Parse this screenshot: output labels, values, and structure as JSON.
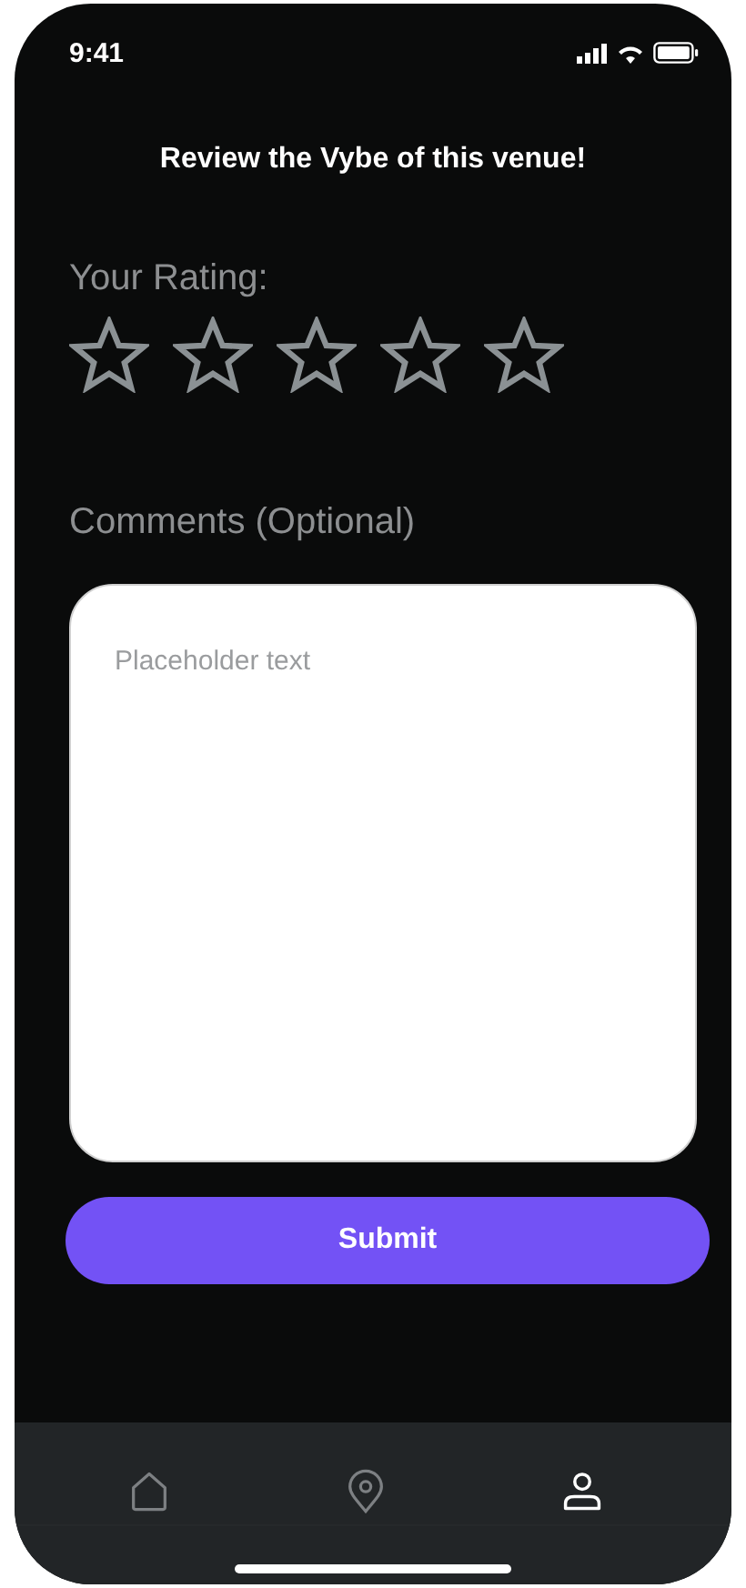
{
  "status_bar": {
    "time": "9:41"
  },
  "title": "Review the Vybe of this venue!",
  "rating": {
    "label": "Your Rating:",
    "stars": 0
  },
  "comments": {
    "label": "Comments (Optional)",
    "placeholder": "Placeholder text"
  },
  "submit": {
    "label": "Submit"
  },
  "nav": [
    {
      "kind": "home",
      "selected": false
    },
    {
      "kind": "location",
      "selected": false
    },
    {
      "kind": "profile",
      "selected": true
    }
  ]
}
